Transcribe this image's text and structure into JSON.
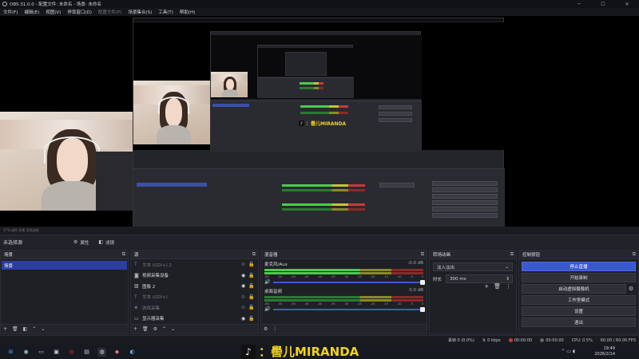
{
  "window": {
    "title": "OBS 31.0.0 - 配置文件: 未命名 - 场景: 未命名"
  },
  "menu": [
    {
      "label": "文件(F)",
      "enabled": true
    },
    {
      "label": "编辑(E)",
      "enabled": true
    },
    {
      "label": "视图(V)",
      "enabled": true
    },
    {
      "label": "停靠窗口(D)",
      "enabled": true
    },
    {
      "label": "配置文件(P)",
      "enabled": false
    },
    {
      "label": "场景集合(S)",
      "enabled": true
    },
    {
      "label": "工具(T)",
      "enabled": true
    },
    {
      "label": "帮助(H)",
      "enabled": true
    }
  ],
  "overlay": {
    "brand_text": "：嚳儿MIRANDA"
  },
  "preview_status": "57%   绿色  背景   音频滤镜",
  "toolbar": {
    "selection_label": "未选择源",
    "properties": "属性",
    "filters": "滤镜"
  },
  "scenes": {
    "title": "场景",
    "items": [
      "场景"
    ]
  },
  "sources": {
    "title": "源",
    "items": [
      {
        "name": "文本 (GDI+) 2",
        "icon": "text-icon",
        "visible": false,
        "enabled": false
      },
      {
        "name": "视频采集设备",
        "icon": "camera-icon",
        "visible": true,
        "enabled": true
      },
      {
        "name": "图像 2",
        "icon": "image-icon",
        "visible": true,
        "enabled": true
      },
      {
        "name": "文本 (GDI+)",
        "icon": "text-icon",
        "visible": false,
        "enabled": false
      },
      {
        "name": "游戏采集",
        "icon": "gamepad-icon",
        "visible": false,
        "enabled": false
      },
      {
        "name": "显示器采集",
        "icon": "monitor-icon",
        "visible": true,
        "enabled": true
      }
    ]
  },
  "mixer": {
    "title": "混音器",
    "channels": [
      {
        "name": "麦克风/Aux",
        "db": "-0.0 dB",
        "level": 0.62
      },
      {
        "name": "桌面音频",
        "db": "0.0 dB",
        "level": 0.0
      }
    ],
    "ticks": [
      "-60",
      "-55",
      "-50",
      "-45",
      "-40",
      "-35",
      "-30",
      "-25",
      "-20",
      "-15",
      "-10",
      "-5",
      "0"
    ]
  },
  "transitions": {
    "title": "转场动画",
    "selected": "淡入淡出",
    "duration_label": "时长",
    "duration_value": "300 ms"
  },
  "controls": {
    "title": "控制按钮",
    "stop_stream": "停止直播",
    "start_record": "开始录制",
    "virtual_cam": "启动虚拟摄像机",
    "studio_mode": "工作室模式",
    "settings": "设置",
    "exit": "退出"
  },
  "status": {
    "dropped": "丢帧 0 (0.0%)",
    "bitrate": "0 kbps",
    "stream_time": "00:00:00",
    "rec_time": "00:00:00",
    "cpu": "CPU: 0.5%",
    "fps": "60.00 / 60.00 FPS"
  },
  "clock": {
    "time": "19:49",
    "date": "2026/2/14"
  },
  "colors": {
    "accent": "#3a58d0",
    "selected": "#2c3ea0",
    "brand_yellow": "#f3d21c"
  }
}
